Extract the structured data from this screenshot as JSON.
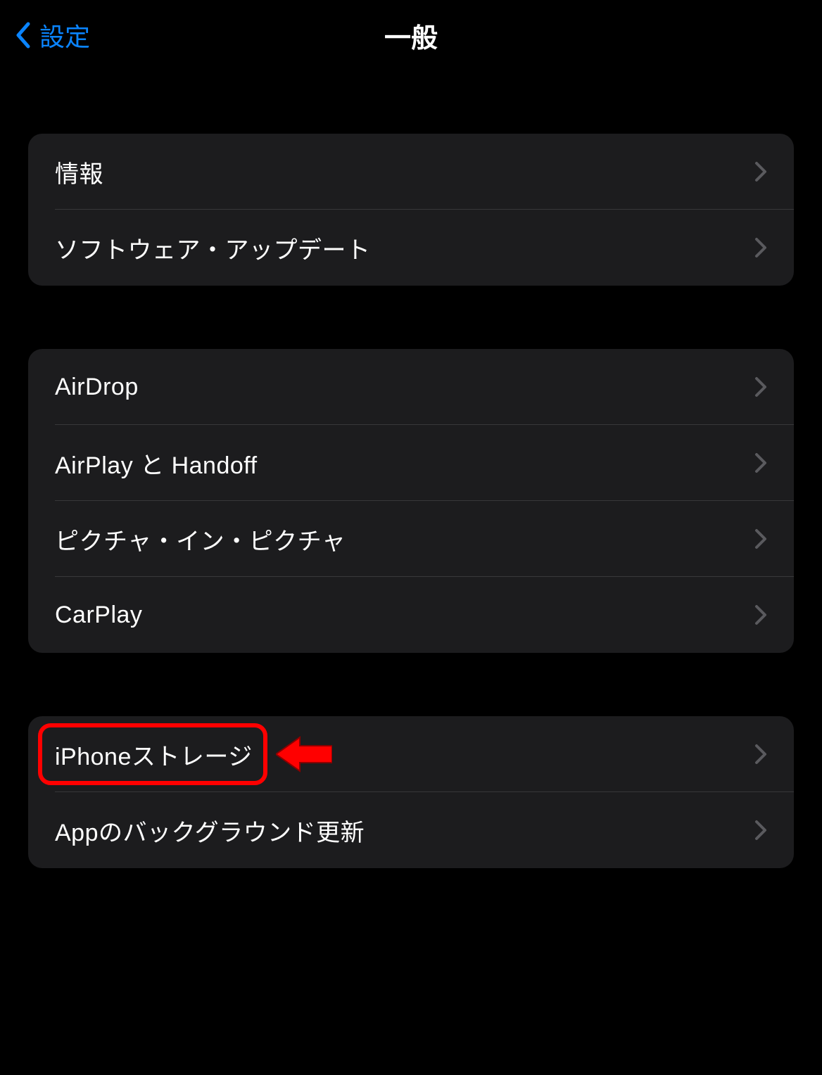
{
  "nav": {
    "back_label": "設定",
    "title": "一般"
  },
  "sections": [
    {
      "items": [
        {
          "label": "情報",
          "name": "about"
        },
        {
          "label": "ソフトウェア・アップデート",
          "name": "software-update"
        }
      ]
    },
    {
      "items": [
        {
          "label": "AirDrop",
          "name": "airdrop"
        },
        {
          "label": "AirPlay と Handoff",
          "name": "airplay-handoff"
        },
        {
          "label": "ピクチャ・イン・ピクチャ",
          "name": "picture-in-picture"
        },
        {
          "label": "CarPlay",
          "name": "carplay"
        }
      ]
    },
    {
      "items": [
        {
          "label": "iPhoneストレージ",
          "name": "iphone-storage",
          "highlighted": true
        },
        {
          "label": "Appのバックグラウンド更新",
          "name": "background-app-refresh"
        }
      ]
    }
  ],
  "colors": {
    "accent": "#0a84ff",
    "highlight": "#ff0000",
    "background": "#000000",
    "section_bg": "#1c1c1e"
  }
}
